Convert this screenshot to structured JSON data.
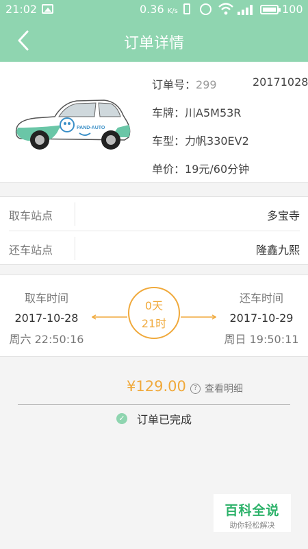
{
  "statusbar": {
    "time": "21:02",
    "speed": "0.36",
    "speed_unit": "K/s",
    "battery": "100"
  },
  "header": {
    "title": "订单详情"
  },
  "order": {
    "order_no_label": "订单号：",
    "order_no_value": "299",
    "order_date": "20171028",
    "plate_label": "车牌：",
    "plate_value": "川A5M53R",
    "model_label": "车型：",
    "model_value": "力帆330EV2",
    "price_label": "单价：",
    "price_value": "19元/60分钟",
    "car_logo_text": "PAND-AUTO"
  },
  "stations": {
    "pickup_label": "取车站点",
    "pickup_value": "多宝寺",
    "return_label": "还车站点",
    "return_value": "隆鑫九熙"
  },
  "times": {
    "pickup_label": "取车时间",
    "pickup_date": "2017-10-28",
    "pickup_week_time": "周六 22:50:16",
    "return_label": "还车时间",
    "return_date": "2017-10-29",
    "return_week_time": "周日 19:50:11",
    "duration_days": "0天",
    "duration_hours": "21时"
  },
  "payment": {
    "amount": "¥129.00",
    "detail_label": "查看明细",
    "status": "订单已完成"
  },
  "watermark": {
    "title": "百科全说",
    "subtitle": "助你轻松解决"
  },
  "colors": {
    "header_green": "#8fd5b0",
    "accent_orange": "#f0a93b"
  }
}
